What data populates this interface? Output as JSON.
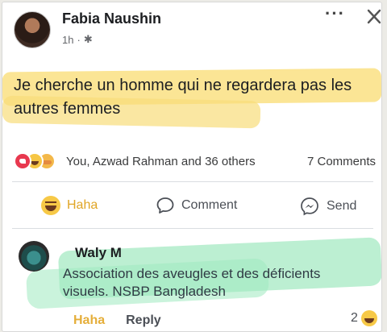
{
  "post": {
    "author": "Fabia Naushin",
    "time": "1h",
    "separator": "·",
    "text": "Je cherche un homme qui ne regardera pas les autres femmes"
  },
  "reactions": {
    "summary": "You, Azwad Rahman and 36 others",
    "comment_count": "7 Comments",
    "icons": [
      "love-icon",
      "haha-icon",
      "care-icon"
    ]
  },
  "actions": {
    "haha": "Haha",
    "comment": "Comment",
    "send": "Send"
  },
  "comment": {
    "author": "Waly M",
    "text": "Association des aveugles et des déficients visuels. NSBP Bangladesh",
    "haha": "Haha",
    "reply": "Reply",
    "reaction_count": "2"
  },
  "colors": {
    "yellow_highlight": "#f9dc72",
    "green_highlight": "#8fe5b4",
    "haha_yellow": "#e0a525"
  }
}
